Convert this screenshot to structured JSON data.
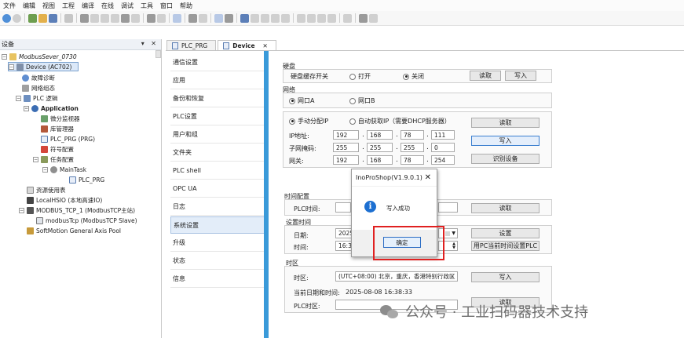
{
  "menu": [
    "文件",
    "编辑",
    "视图",
    "工程",
    "编译",
    "在线",
    "调试",
    "工具",
    "窗口",
    "帮助"
  ],
  "devices_panel": {
    "title": "设备",
    "controls": "▾ ✕",
    "tree": [
      {
        "label": "ModbusSever_0730",
        "icon": "project-icon"
      },
      {
        "label": "Device (AC702)",
        "icon": "plc-device-icon"
      },
      {
        "label": "故障诊断",
        "icon": "diagnosis-icon"
      },
      {
        "label": "网络组态",
        "icon": "network-icon"
      },
      {
        "label": "PLC 逻辑",
        "icon": "plc-logic-icon"
      },
      {
        "label": "Application",
        "icon": "application-icon"
      },
      {
        "label": "微分监视器",
        "icon": "monitor-icon"
      },
      {
        "label": "库管理器",
        "icon": "library-icon"
      },
      {
        "label": "PLC_PRG (PRG)",
        "icon": "pou-icon"
      },
      {
        "label": "符号配置",
        "icon": "symbol-icon"
      },
      {
        "label": "任务配置",
        "icon": "task-config-icon"
      },
      {
        "label": "MainTask",
        "icon": "task-icon"
      },
      {
        "label": "PLC_PRG",
        "icon": "pou-call-icon"
      },
      {
        "label": "资源使用表",
        "icon": "resource-icon"
      },
      {
        "label": "LocalHSIO (本地高速IO)",
        "icon": "io-icon"
      },
      {
        "label": "MODBUS_TCP_1 (ModbusTCP主站)",
        "icon": "modbus-master-icon"
      },
      {
        "label": "modbusTcp (ModbusTCP Slave)",
        "icon": "modbus-slave-icon"
      },
      {
        "label": "SoftMotion General Axis Pool",
        "icon": "axis-pool-icon"
      }
    ]
  },
  "tabs": [
    {
      "label": "PLC_PRG"
    },
    {
      "label": "Device",
      "close": "✕"
    }
  ],
  "settings_nav": [
    "通信设置",
    "应用",
    "备份和恢复",
    "PLC设置",
    "用户和组",
    "文件夹",
    "PLC shell",
    "OPC UA",
    "日志",
    "系统设置",
    "升级",
    "状态",
    "信息"
  ],
  "disk": {
    "section": "硬盘",
    "label": "硬盘缓存开关",
    "opt_open": "打开",
    "opt_close": "关闭",
    "read": "读取",
    "write": "写入"
  },
  "network": {
    "section": "网络",
    "port_a": "网口A",
    "port_b": "网口B",
    "manual_ip": "手动分配IP",
    "auto_ip": "自动获取IP（需要DHCP服务器）",
    "ip_label": "IP地址:",
    "mask_label": "子网掩码:",
    "gw_label": "网关:",
    "ip": [
      "192",
      "168",
      "78",
      "111"
    ],
    "mask": [
      "255",
      "255",
      "255",
      "0"
    ],
    "gateway": [
      "192",
      "168",
      "78",
      "254"
    ],
    "read": "读取",
    "write": "写入",
    "identify": "识别设备"
  },
  "time_config": {
    "section": "时间配置",
    "plc_time_label": "PLC时间:",
    "read": "读取",
    "set_time_section": "设置时间",
    "date_label": "日期:",
    "date_value": "2025/",
    "time_label": "时间:",
    "time_value": "16:38",
    "set": "设置",
    "set_from_pc": "用PC当前时间设置PLC"
  },
  "timezone": {
    "section": "时区",
    "label": "时区:",
    "value": "(UTC+08:00) 北京，重庆，香港特别行政区",
    "write": "写入",
    "current_label": "当前日期和时间:",
    "current_value": "2025-08-08 16:38:33",
    "plc_tz_label": "PLC时区:",
    "read": "读取"
  },
  "dialog": {
    "title": "InoProShop(V1.9.0.1)",
    "close": "✕",
    "info": "i",
    "message": "写入成功",
    "ok": "确定"
  },
  "watermark": {
    "text": "公众号 · 工业扫码器技术支持"
  }
}
